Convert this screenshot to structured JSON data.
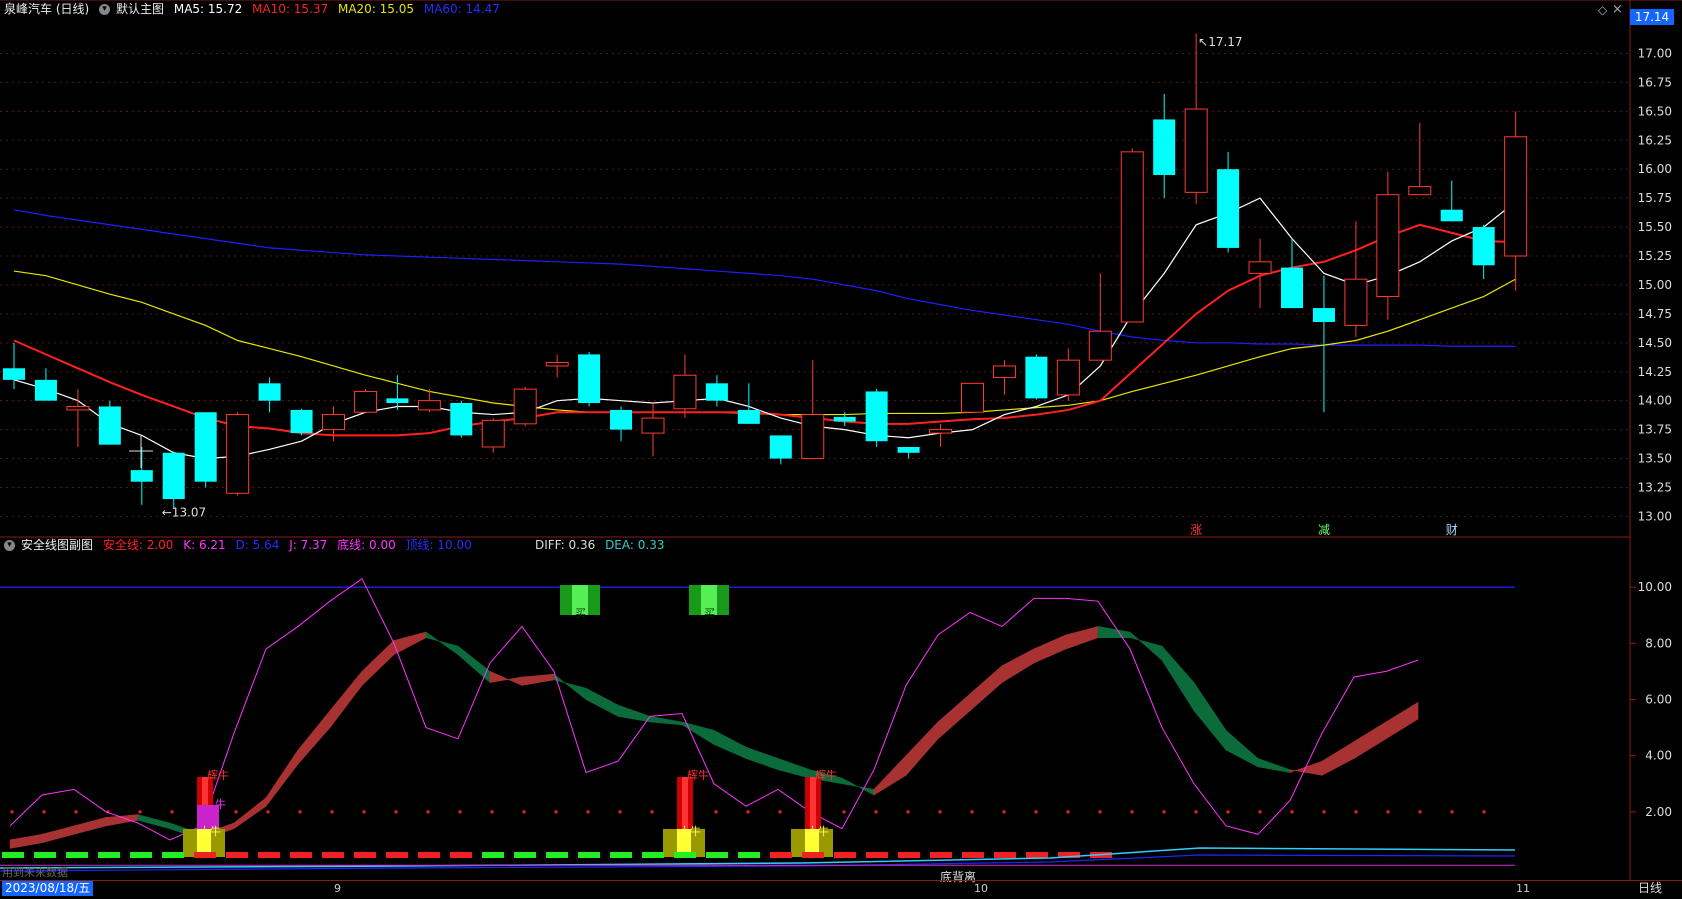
{
  "main_header": {
    "stock": "泉峰汽车 (日线)",
    "template": "默认主图",
    "ma5": "MA5: 15.72",
    "ma10": "MA10: 15.37",
    "ma20": "MA20: 15.05",
    "ma60": "MA60: 14.47"
  },
  "sub_header": {
    "name": "安全线图副图",
    "safe": "安全线: 2.00",
    "k": "K: 6.21",
    "d": "D: 5.64",
    "j": "J: 7.37",
    "bottom": "底线: 0.00",
    "top": "顶线: 10.00",
    "diff": "DIFF: 0.36",
    "dea": "DEA: 0.33"
  },
  "current_price": "17.14",
  "high_label": "17.17",
  "low_label": "13.07",
  "future_note": "用到未来数据",
  "divergence_label": "底背离",
  "date_display": "2023/08/18/五",
  "period": "日线",
  "x_ticks": [
    "9",
    "10",
    "11"
  ],
  "markers": [
    "涨",
    "减",
    "财"
  ],
  "signal_text": "买",
  "signal_labels": {
    "bull_top": "辉牛",
    "bull_mid": "牛",
    "big_bull": "大牛"
  },
  "colors": {
    "up": "#ff3b30",
    "down": "#00ffff",
    "ma5": "#ffffff",
    "ma10": "#ff2020",
    "ma20": "#e6e600",
    "ma60": "#1e1eff",
    "k_line": "#ff33ff",
    "ribbon_up": "#a83232",
    "ribbon_down": "#0b6b3a"
  },
  "chart_data": [
    {
      "type": "candlestick",
      "title": "泉峰汽车 (日线)",
      "y_ticks": [
        "17.00",
        "16.75",
        "16.50",
        "16.25",
        "16.00",
        "15.75",
        "15.50",
        "15.25",
        "15.00",
        "14.75",
        "14.50",
        "14.25",
        "14.00",
        "13.75",
        "13.50",
        "13.25",
        "13.00"
      ],
      "ylim": [
        12.9,
        17.22
      ],
      "candles": [
        {
          "o": 14.28,
          "h": 14.5,
          "l": 14.1,
          "c": 14.18
        },
        {
          "o": 14.18,
          "h": 14.28,
          "l": 14.0,
          "c": 14.0
        },
        {
          "o": 13.92,
          "h": 14.1,
          "l": 13.6,
          "c": 13.95
        },
        {
          "o": 13.95,
          "h": 14.0,
          "l": 13.62,
          "c": 13.62
        },
        {
          "o": 13.4,
          "h": 13.6,
          "l": 13.1,
          "c": 13.3
        },
        {
          "o": 13.55,
          "h": 13.56,
          "l": 13.07,
          "c": 13.15
        },
        {
          "o": 13.9,
          "h": 13.9,
          "l": 13.25,
          "c": 13.3
        },
        {
          "o": 13.2,
          "h": 13.9,
          "l": 13.18,
          "c": 13.88
        },
        {
          "o": 14.15,
          "h": 14.2,
          "l": 13.9,
          "c": 14.0
        },
        {
          "o": 13.92,
          "h": 13.93,
          "l": 13.7,
          "c": 13.72
        },
        {
          "o": 13.75,
          "h": 13.95,
          "l": 13.65,
          "c": 13.88
        },
        {
          "o": 13.9,
          "h": 14.1,
          "l": 13.9,
          "c": 14.08
        },
        {
          "o": 14.02,
          "h": 14.22,
          "l": 13.92,
          "c": 13.98
        },
        {
          "o": 13.92,
          "h": 14.1,
          "l": 13.9,
          "c": 14.0
        },
        {
          "o": 13.98,
          "h": 14.0,
          "l": 13.68,
          "c": 13.7
        },
        {
          "o": 13.6,
          "h": 13.85,
          "l": 13.55,
          "c": 13.83
        },
        {
          "o": 13.8,
          "h": 14.12,
          "l": 13.78,
          "c": 14.1
        },
        {
          "o": 14.3,
          "h": 14.4,
          "l": 14.2,
          "c": 14.33
        },
        {
          "o": 14.4,
          "h": 14.42,
          "l": 13.95,
          "c": 13.98
        },
        {
          "o": 13.92,
          "h": 13.95,
          "l": 13.65,
          "c": 13.75
        },
        {
          "o": 13.72,
          "h": 13.98,
          "l": 13.52,
          "c": 13.85
        },
        {
          "o": 13.93,
          "h": 14.4,
          "l": 13.85,
          "c": 14.22
        },
        {
          "o": 14.15,
          "h": 14.22,
          "l": 13.95,
          "c": 14.0
        },
        {
          "o": 13.92,
          "h": 14.15,
          "l": 13.8,
          "c": 13.8
        },
        {
          "o": 13.7,
          "h": 13.7,
          "l": 13.45,
          "c": 13.5
        },
        {
          "o": 13.5,
          "h": 14.35,
          "l": 13.5,
          "c": 13.88
        },
        {
          "o": 13.86,
          "h": 13.9,
          "l": 13.78,
          "c": 13.82
        },
        {
          "o": 14.08,
          "h": 14.1,
          "l": 13.6,
          "c": 13.65
        },
        {
          "o": 13.6,
          "h": 13.6,
          "l": 13.5,
          "c": 13.55
        },
        {
          "o": 13.72,
          "h": 13.8,
          "l": 13.6,
          "c": 13.75
        },
        {
          "o": 13.9,
          "h": 14.15,
          "l": 13.9,
          "c": 14.15
        },
        {
          "o": 14.2,
          "h": 14.35,
          "l": 14.05,
          "c": 14.3
        },
        {
          "o": 14.38,
          "h": 14.4,
          "l": 14.01,
          "c": 14.02
        },
        {
          "o": 14.05,
          "h": 14.45,
          "l": 14.0,
          "c": 14.35
        },
        {
          "o": 14.35,
          "h": 15.1,
          "l": 14.35,
          "c": 14.6
        },
        {
          "o": 14.68,
          "h": 16.18,
          "l": 14.68,
          "c": 16.15
        },
        {
          "o": 16.43,
          "h": 16.65,
          "l": 15.75,
          "c": 15.95
        },
        {
          "o": 15.8,
          "h": 17.17,
          "l": 15.7,
          "c": 16.52
        },
        {
          "o": 16.0,
          "h": 16.15,
          "l": 15.28,
          "c": 15.32
        },
        {
          "o": 15.1,
          "h": 15.4,
          "l": 14.8,
          "c": 15.2
        },
        {
          "o": 15.15,
          "h": 15.4,
          "l": 14.8,
          "c": 14.8
        },
        {
          "o": 14.8,
          "h": 15.08,
          "l": 13.9,
          "c": 14.68
        },
        {
          "o": 14.65,
          "h": 15.55,
          "l": 14.55,
          "c": 15.05
        },
        {
          "o": 14.9,
          "h": 15.98,
          "l": 14.7,
          "c": 15.78
        },
        {
          "o": 15.78,
          "h": 16.4,
          "l": 15.78,
          "c": 15.85
        },
        {
          "o": 15.65,
          "h": 15.9,
          "l": 15.55,
          "c": 15.55
        },
        {
          "o": 15.5,
          "h": 15.52,
          "l": 15.05,
          "c": 15.17
        },
        {
          "o": 15.25,
          "h": 16.5,
          "l": 14.95,
          "c": 16.28
        }
      ],
      "ma5": [
        14.18,
        14.1,
        14.0,
        13.8,
        13.7,
        13.55,
        13.5,
        13.52,
        13.58,
        13.65,
        13.8,
        13.9,
        13.95,
        13.95,
        13.9,
        13.88,
        13.9,
        14.0,
        14.02,
        14.0,
        13.98,
        14.0,
        14.02,
        13.95,
        13.85,
        13.78,
        13.75,
        13.7,
        13.68,
        13.72,
        13.75,
        13.88,
        13.95,
        14.05,
        14.3,
        14.75,
        15.1,
        15.52,
        15.62,
        15.75,
        15.4,
        15.1,
        15.0,
        15.08,
        15.2,
        15.38,
        15.5,
        15.72
      ],
      "ma10": [
        14.52,
        14.4,
        14.28,
        14.16,
        14.05,
        13.95,
        13.85,
        13.78,
        13.76,
        13.72,
        13.7,
        13.7,
        13.7,
        13.72,
        13.78,
        13.82,
        13.85,
        13.9,
        13.9,
        13.9,
        13.9,
        13.9,
        13.9,
        13.9,
        13.88,
        13.85,
        13.82,
        13.8,
        13.8,
        13.82,
        13.84,
        13.85,
        13.88,
        13.92,
        14.0,
        14.25,
        14.5,
        14.75,
        14.95,
        15.08,
        15.15,
        15.2,
        15.3,
        15.42,
        15.52,
        15.45,
        15.38,
        15.37
      ],
      "ma20": [
        15.12,
        15.08,
        15.0,
        14.92,
        14.85,
        14.75,
        14.65,
        14.52,
        14.45,
        14.38,
        14.3,
        14.22,
        14.15,
        14.08,
        14.03,
        13.98,
        13.95,
        13.92,
        13.9,
        13.9,
        13.9,
        13.9,
        13.9,
        13.89,
        13.88,
        13.88,
        13.88,
        13.89,
        13.89,
        13.89,
        13.9,
        13.92,
        13.94,
        13.96,
        14.0,
        14.08,
        14.15,
        14.22,
        14.3,
        14.38,
        14.45,
        14.48,
        14.52,
        14.6,
        14.7,
        14.8,
        14.9,
        15.05
      ],
      "ma60": [
        15.65,
        15.6,
        15.56,
        15.52,
        15.48,
        15.44,
        15.4,
        15.36,
        15.32,
        15.3,
        15.28,
        15.26,
        15.25,
        15.24,
        15.23,
        15.22,
        15.21,
        15.2,
        15.19,
        15.18,
        15.16,
        15.14,
        15.12,
        15.1,
        15.08,
        15.05,
        15.0,
        14.95,
        14.88,
        14.83,
        14.78,
        14.74,
        14.7,
        14.66,
        14.6,
        14.55,
        14.52,
        14.5,
        14.5,
        14.49,
        14.49,
        14.48,
        14.48,
        14.48,
        14.48,
        14.47,
        14.47,
        14.47
      ]
    },
    {
      "type": "line",
      "title": "安全线图副图",
      "y_ticks": [
        "10.00",
        "8.00",
        "6.00",
        "4.00",
        "2.00"
      ],
      "ylim": [
        0,
        11.5
      ],
      "safe_line": 2.0,
      "top_line": 10.0,
      "k_line": [
        1.5,
        2.6,
        2.8,
        2.0,
        1.6,
        1.0,
        1.5,
        4.8,
        7.8,
        8.6,
        9.5,
        10.3,
        8.0,
        5.0,
        4.6,
        7.3,
        8.6,
        7.0,
        3.4,
        3.8,
        5.4,
        5.5,
        3.0,
        2.2,
        2.8,
        2.0,
        1.4,
        3.5,
        6.5,
        8.3,
        9.1,
        8.6,
        9.6,
        9.6,
        9.5,
        7.8,
        5.0,
        3.0,
        1.5,
        1.2,
        2.4,
        4.8,
        6.8,
        7.0,
        7.4
      ],
      "ribbon_a": [
        1.0,
        1.2,
        1.5,
        1.8,
        1.9,
        1.6,
        1.2,
        1.6,
        2.5,
        4.2,
        5.6,
        7.0,
        8.1,
        8.4,
        7.6,
        6.6,
        6.8,
        6.9,
        6.0,
        5.4,
        5.2,
        5.1,
        4.4,
        3.9,
        3.5,
        3.2,
        3.0,
        2.8,
        4.0,
        5.2,
        6.2,
        7.2,
        7.8,
        8.3,
        8.6,
        8.4,
        7.4,
        5.6,
        4.2,
        3.6,
        3.4,
        3.8,
        4.5,
        5.2,
        5.9
      ],
      "ribbon_b": [
        0.7,
        0.9,
        1.2,
        1.5,
        1.7,
        1.4,
        1.0,
        1.4,
        2.2,
        3.7,
        5.0,
        6.5,
        7.6,
        8.2,
        7.9,
        7.0,
        6.5,
        6.7,
        6.4,
        5.8,
        5.4,
        5.2,
        4.9,
        4.3,
        3.9,
        3.5,
        3.2,
        2.6,
        3.3,
        4.6,
        5.6,
        6.6,
        7.3,
        7.8,
        8.2,
        8.2,
        7.9,
        6.6,
        4.9,
        3.9,
        3.5,
        3.3,
        3.9,
        4.6,
        5.3
      ]
    }
  ]
}
